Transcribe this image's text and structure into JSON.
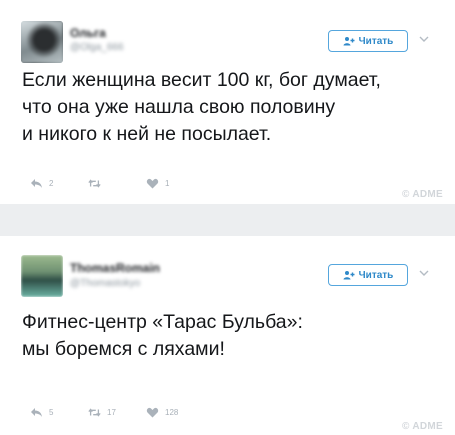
{
  "tweets": [
    {
      "user_name": "Ольга",
      "user_handle": "@Olga_666",
      "follow_label": "Читать",
      "text": "Если женщина весит 100 кг, бог думает,\nчто она уже нашла свою половину\nи никого к ней не посылает.",
      "reply_count": "2",
      "retweet_count": "",
      "like_count": "1",
      "watermark": "© ADME"
    },
    {
      "user_name": "ThomasRomain",
      "user_handle": "@Thomastokyo",
      "follow_label": "Читать",
      "text": "Фитнес-центр «Тарас Бульба»:\nмы боремся с ляхами!",
      "reply_count": "5",
      "retweet_count": "17",
      "like_count": "128",
      "watermark": "© ADME"
    }
  ],
  "colors": {
    "accent": "#2f89c9",
    "background": "#eceef0",
    "card": "#ffffff",
    "muted": "#a8b0b8"
  },
  "icons": {
    "follow": "add-person-icon",
    "menu": "chevron-down-icon",
    "reply": "reply-icon",
    "retweet": "retweet-icon",
    "like": "heart-icon"
  }
}
